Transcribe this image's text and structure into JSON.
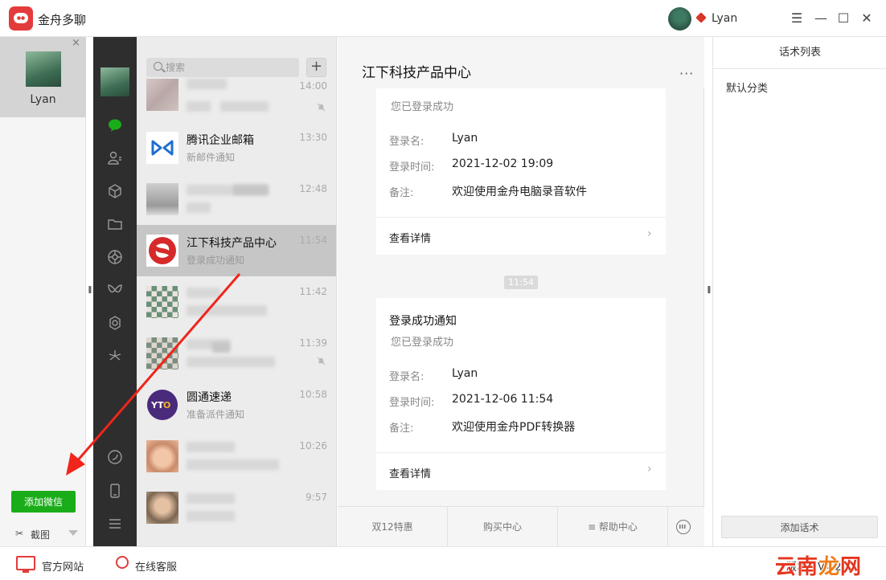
{
  "app": {
    "title": "金舟多聊",
    "user_name": "Lyan"
  },
  "window_controls": {
    "menu": "☰",
    "minimize": "—",
    "maximize": "☐",
    "close": "✕"
  },
  "account_panel": {
    "account_name": "Lyan",
    "close": "×",
    "add_button": "添加微信",
    "screenshot_label": "截图"
  },
  "search": {
    "placeholder": "搜索",
    "add": "+"
  },
  "chats": [
    {
      "name": "",
      "preview": "",
      "time": "14:00",
      "muted": true,
      "blurred": true
    },
    {
      "name": "腾讯企业邮箱",
      "preview": "新邮件通知",
      "time": "13:30",
      "muted": false,
      "blurred": false
    },
    {
      "name": "",
      "preview": "",
      "time": "12:48",
      "muted": false,
      "blurred": true
    },
    {
      "name": "江下科技产品中心",
      "preview": "登录成功通知",
      "time": "11:54",
      "muted": false,
      "blurred": false,
      "active": true
    },
    {
      "name": "",
      "preview": "",
      "time": "11:42",
      "muted": false,
      "blurred": true
    },
    {
      "name": "",
      "preview": "",
      "time": "11:39",
      "muted": true,
      "blurred": true
    },
    {
      "name": "圆通速递",
      "preview": "准备派件通知",
      "time": "10:58",
      "muted": false,
      "blurred": false
    },
    {
      "name": "",
      "preview": "",
      "time": "10:26",
      "muted": false,
      "blurred": true
    },
    {
      "name": "",
      "preview": "",
      "time": "9:57",
      "muted": false,
      "blurred": true
    }
  ],
  "conversation": {
    "title": "江下科技产品中心",
    "more": "···",
    "time_divider": "11:54",
    "cards": [
      {
        "heading": "",
        "subtitle": "您已登录成功",
        "fields": [
          {
            "label": "登录名:",
            "value": "Lyan"
          },
          {
            "label": "登录时间:",
            "value": "2021-12-02 19:09"
          },
          {
            "label": "备注:",
            "value": "欢迎使用金舟电脑录音软件"
          }
        ],
        "link": "查看详情"
      },
      {
        "heading": "登录成功通知",
        "subtitle": "您已登录成功",
        "fields": [
          {
            "label": "登录名:",
            "value": "Lyan"
          },
          {
            "label": "登录时间:",
            "value": "2021-12-06 11:54"
          },
          {
            "label": "备注:",
            "value": "欢迎使用金舟PDF转换器"
          }
        ],
        "link": "查看详情"
      }
    ],
    "menu": [
      "双12特惠",
      "购买中心",
      "≡ 帮助中心"
    ]
  },
  "scripts_panel": {
    "title": "话术列表",
    "category": "默认分类",
    "add_button": "添加话术"
  },
  "bottom": {
    "site_label": "官方网站",
    "support_label": "在线客服",
    "version": "版本：V4.2.2",
    "watermark": "云南龙网"
  },
  "colors": {
    "brand_red": "#e33b3b",
    "wechat_green": "#1aad19",
    "rail_dark": "#2e2e2e",
    "annotation_red": "#f0251c"
  }
}
